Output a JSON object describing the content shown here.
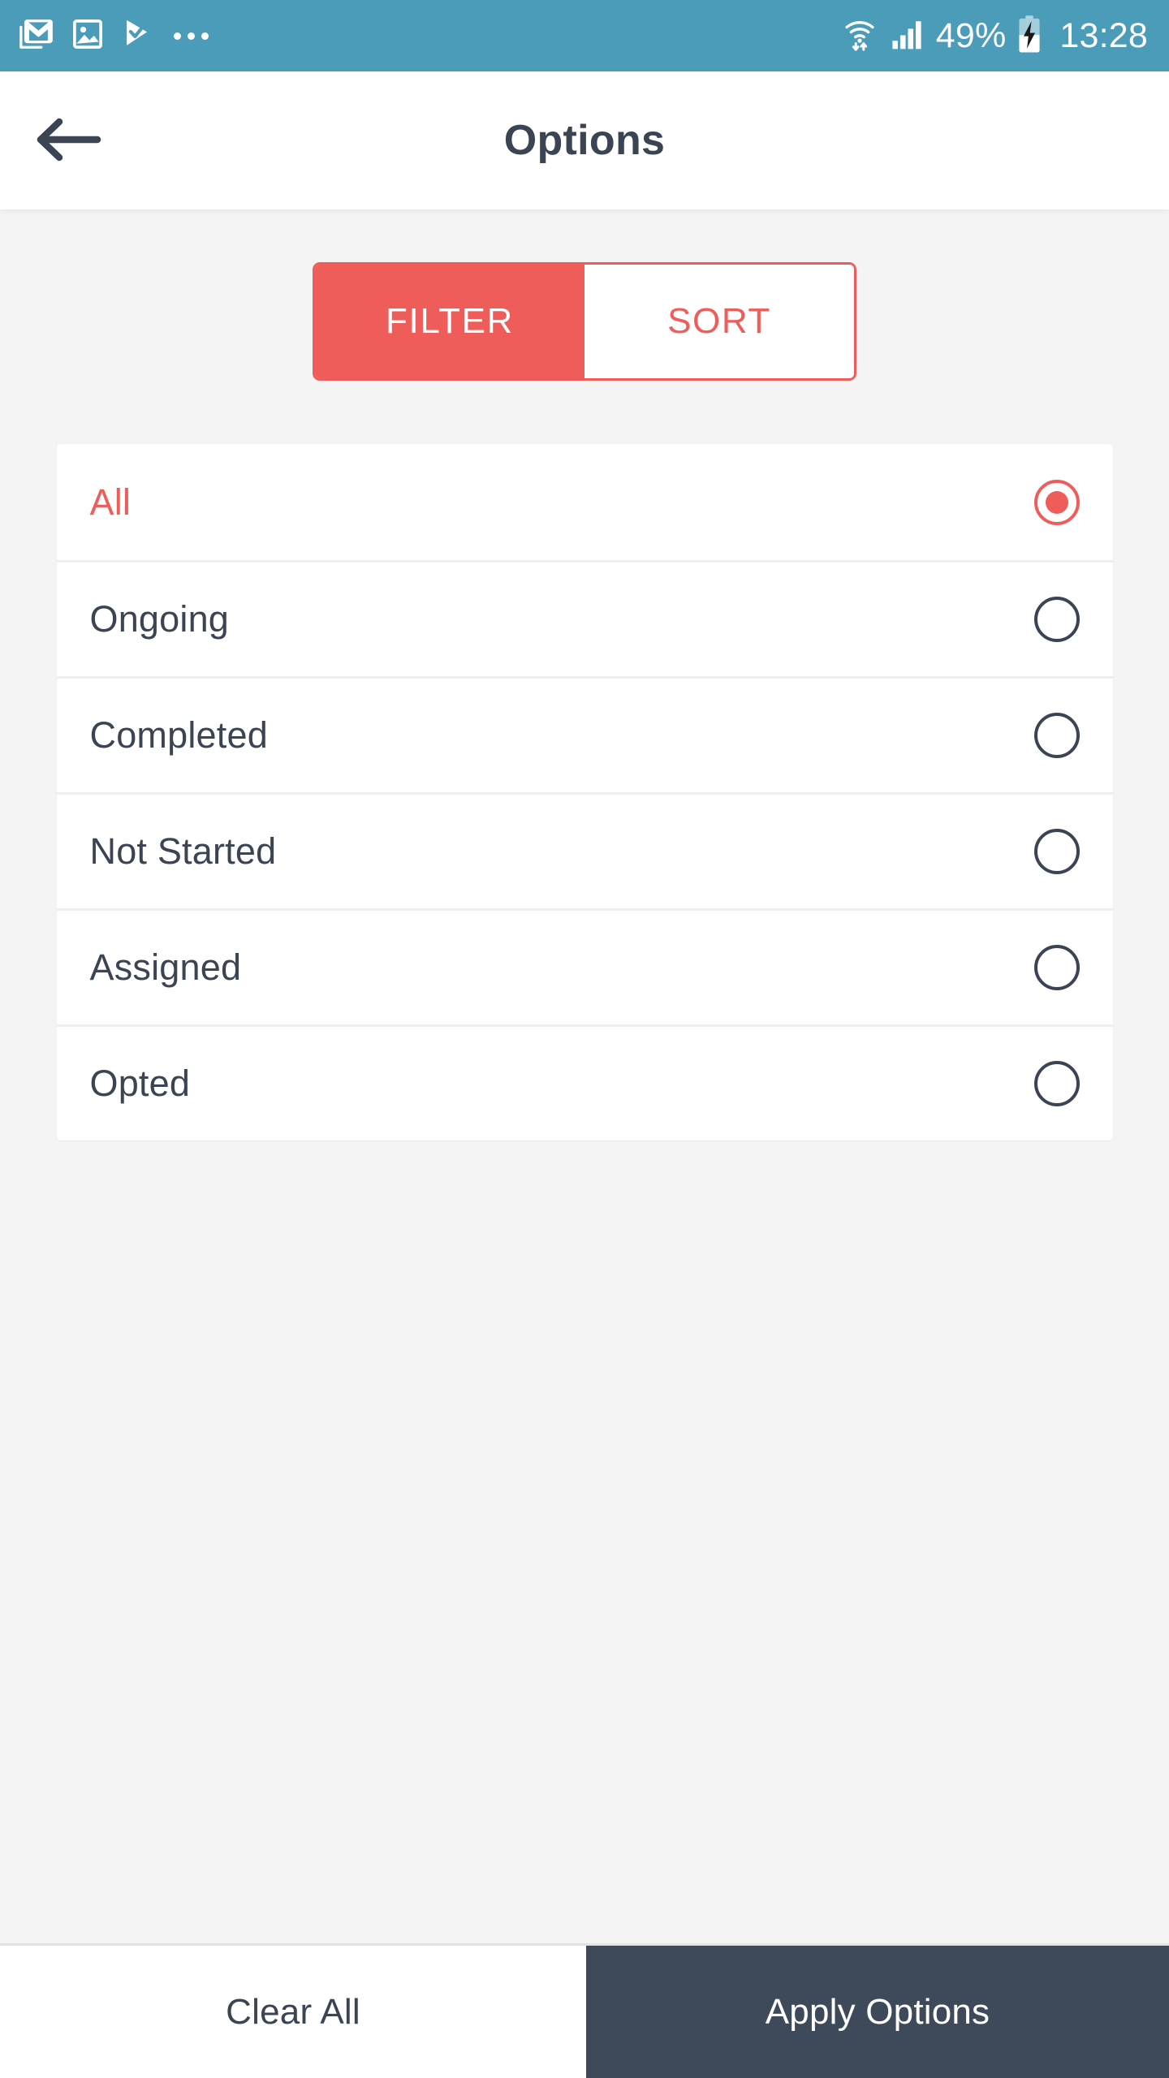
{
  "status_bar": {
    "background_color": "#4a9cb8",
    "left_icons": [
      {
        "name": "gmail-icon",
        "label": "Gmail"
      },
      {
        "name": "image-icon",
        "label": "Screenshot"
      },
      {
        "name": "play-store-update-icon",
        "label": "Play Store"
      },
      {
        "name": "more-notifications-icon",
        "label": "..."
      }
    ],
    "right_icons": [
      {
        "name": "wifi-icon",
        "label": "Wi-Fi"
      },
      {
        "name": "cellular-signal-icon",
        "label": "Signal"
      },
      {
        "name": "battery-charging-icon",
        "label": "Battery charging"
      }
    ],
    "battery_percent": "49%",
    "clock": "13:28"
  },
  "app_bar": {
    "back_icon": "arrow-left-icon",
    "title": "Options",
    "title_color": "#3b4453",
    "background_color": "#ffffff"
  },
  "segmented_control": {
    "accent_color": "#ef5d5b",
    "tabs": [
      {
        "label": "FILTER",
        "active": true
      },
      {
        "label": "SORT",
        "active": false
      }
    ]
  },
  "filter_options": {
    "selected_index": 0,
    "items": [
      {
        "label": "All",
        "selected": true
      },
      {
        "label": "Ongoing",
        "selected": false
      },
      {
        "label": "Completed",
        "selected": false
      },
      {
        "label": "Not Started",
        "selected": false
      },
      {
        "label": "Assigned",
        "selected": false
      },
      {
        "label": "Opted",
        "selected": false
      }
    ]
  },
  "bottom_bar": {
    "clear_label": "Clear All",
    "apply_label": "Apply Options",
    "apply_background_color": "#3e4a5a",
    "clear_background_color": "#ffffff"
  },
  "theme": {
    "accent": "#ef5d5b",
    "dark_slate": "#3b4453",
    "page_background": "#f4f4f4",
    "status_bar": "#4a9cb8"
  }
}
